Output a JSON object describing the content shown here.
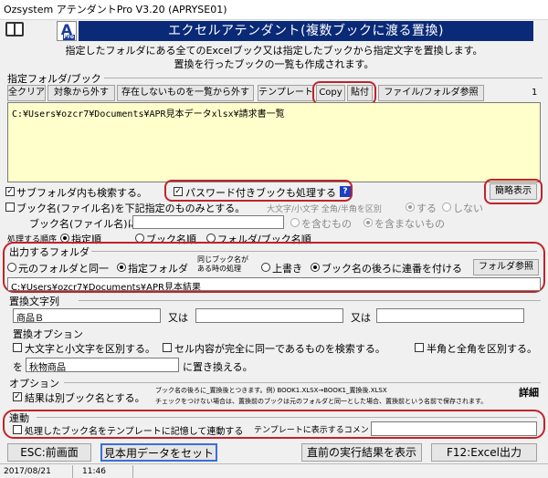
{
  "window": {
    "title": "Ozsystem アテンダントPro V3.20 (APRYSE01)"
  },
  "header": {
    "banner": "エクセルアテンダント(複数ブックに渡る置換)",
    "logo_letter": "A",
    "logo_sub": "Pro",
    "desc1": "指定したフォルダにある全てのExcelブック又は指定したブックから指定文字を置換します。",
    "desc2": "置換を行ったブックの一覧も作成されます。"
  },
  "folder_section": {
    "label": "指定フォルダ/ブック",
    "buttons": {
      "clear": "全クリア",
      "remove": "対象から外す",
      "remove_missing": "存在しないものを一覧から外す",
      "template": "テンプレート",
      "copy": "Copy",
      "paste": "貼付",
      "browse": "ファイル/フォルダ参照"
    },
    "count": "1",
    "path_list": "C:¥Users¥ozcr7¥Documents¥APR見本データxlsx¥請求書一覧"
  },
  "options_top": {
    "subfolder": "サブフォルダ内も検索する。",
    "password": "パスワード付きブックも処理する",
    "help": "?",
    "simple_view": "簡略表示",
    "bookname_only": "ブック名(ファイル名)を下記指定のものみとする。",
    "case_label": "大文字/小文字 全角/半角を区別",
    "case_yes": "する",
    "case_no": "しない",
    "bookname_field_label": "ブック名(ファイル名)に",
    "bookname_value": "",
    "include": "を含むもの",
    "exclude": "を含まないもの",
    "order_label": "処理する順序",
    "order_specified": "指定順",
    "order_bookname": "ブック名順",
    "order_folder": "フォルダ/ブック名順"
  },
  "output": {
    "label": "出力するフォルダ",
    "same_folder": "元のフォルダと同一",
    "specified_folder": "指定フォルダ",
    "same_name_1": "同じブック名が",
    "same_name_2": "ある時の処理",
    "overwrite": "上書き",
    "append_number": "ブック名の後ろに連番を付ける",
    "browse": "フォルダ参照",
    "path": "C:¥Users¥ozcr7¥Documents¥APR見本結果"
  },
  "replace": {
    "label": "置換文字列",
    "field1": "商品Ｂ",
    "or1": "又は",
    "field2": "",
    "or2": "又は",
    "field3": "",
    "options_label": "置換オプション",
    "case_sensitive": "大文字と小文字を区別する。",
    "whole_cell": "セル内容が完全に同一であるものを検索する。",
    "width_sensitive": "半角と全角を区別する。",
    "wo": "を",
    "replace_with": "秋物商品",
    "replace_suffix": "に置き換える。"
  },
  "options": {
    "label": "オプション",
    "separate_name": "結果は別ブック名とする。",
    "note1": "ブック名の後ろに_置換後とつきます。例) BOOK1.XLSX→BOOK1_置換後.XLSX",
    "note2": "チェックをつけない場合は、置換前のブックは元のフォルダと同一とした場合、置換前という名前で保存されます。",
    "detail": "詳細"
  },
  "link": {
    "label": "連動",
    "remember": "処理したブック名をテンプレートに記憶して連動する",
    "comment_label": "テンプレートに表示するコメント",
    "comment_value": ""
  },
  "bottom": {
    "esc": "ESC:前画面",
    "sample": "見本用データをセット",
    "prev_result": "直前の実行結果を表示",
    "f12": "F12:Excel出力"
  },
  "status": {
    "date": "2017/08/21",
    "time": "11:46"
  }
}
